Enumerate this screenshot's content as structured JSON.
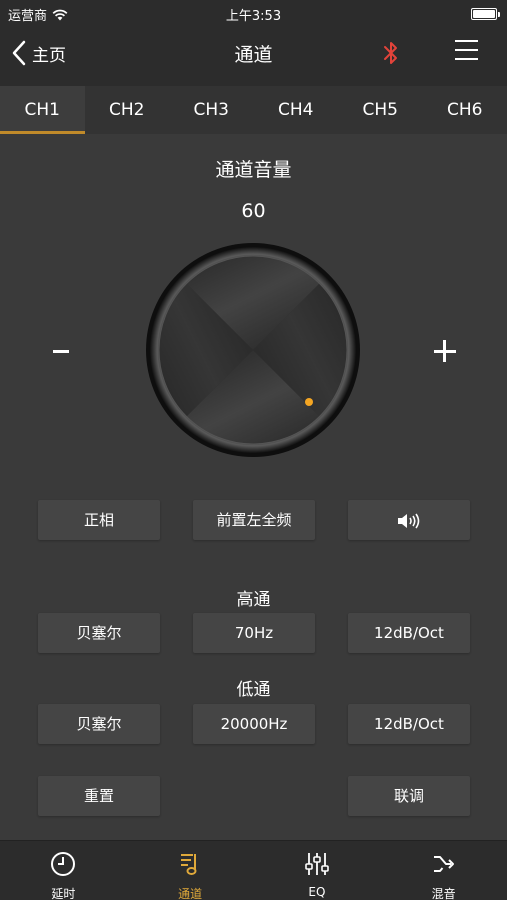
{
  "status_bar": {
    "carrier": "运营商",
    "time": "上午3:53"
  },
  "nav": {
    "back_label": "主页",
    "title": "通道",
    "bluetooth_color": "#e2433a"
  },
  "channel_tabs": [
    {
      "label": "CH1",
      "active": true
    },
    {
      "label": "CH2",
      "active": false
    },
    {
      "label": "CH3",
      "active": false
    },
    {
      "label": "CH4",
      "active": false
    },
    {
      "label": "CH5",
      "active": false
    },
    {
      "label": "CH6",
      "active": false
    }
  ],
  "volume": {
    "label": "通道音量",
    "value": "60",
    "minus_icon": "minus-icon",
    "plus_icon": "plus-icon",
    "indicator_color": "#f5a623"
  },
  "controls": {
    "phase": "正相",
    "input_source": "前置左全频",
    "mute_icon": "speaker-icon"
  },
  "high_pass": {
    "label": "高通",
    "filter_type": "贝塞尔",
    "frequency": "70Hz",
    "slope": "12dB/Oct"
  },
  "low_pass": {
    "label": "低通",
    "filter_type": "贝塞尔",
    "frequency": "20000Hz",
    "slope": "12dB/Oct"
  },
  "actions": {
    "reset": "重置",
    "link": "联调"
  },
  "bottom_tabs": [
    {
      "label": "延时",
      "icon": "clock-icon",
      "active": false
    },
    {
      "label": "通道",
      "icon": "channel-icon",
      "active": true
    },
    {
      "label": "EQ",
      "icon": "eq-sliders-icon",
      "active": false
    },
    {
      "label": "混音",
      "icon": "mix-icon",
      "active": false
    }
  ],
  "colors": {
    "accent": "#e0a93a",
    "background": "#3a3a3a",
    "bar_background": "#2c2c2c",
    "button_background": "#454545"
  }
}
